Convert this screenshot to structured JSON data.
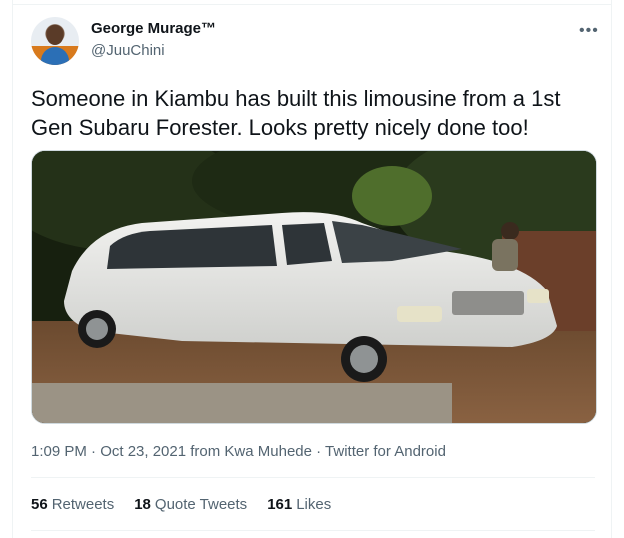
{
  "tweet": {
    "author_name": "George Murage™",
    "author_handle": "@JuuChini",
    "more_label": "•••",
    "text": "Someone in Kiambu has built this limousine from a 1st Gen Subaru Forester. Looks pretty nicely done too!",
    "timestamp_source": "1:09 PM · Oct 23, 2021 from Kwa Muhede · Twitter for Android"
  },
  "stats": [
    {
      "count": "56",
      "label": "Retweets"
    },
    {
      "count": "18",
      "label": "Quote Tweets"
    },
    {
      "count": "161",
      "label": "Likes"
    }
  ],
  "colors": {
    "text": "#0f1419",
    "secondary": "#536471",
    "divider": "#eff3f4"
  }
}
